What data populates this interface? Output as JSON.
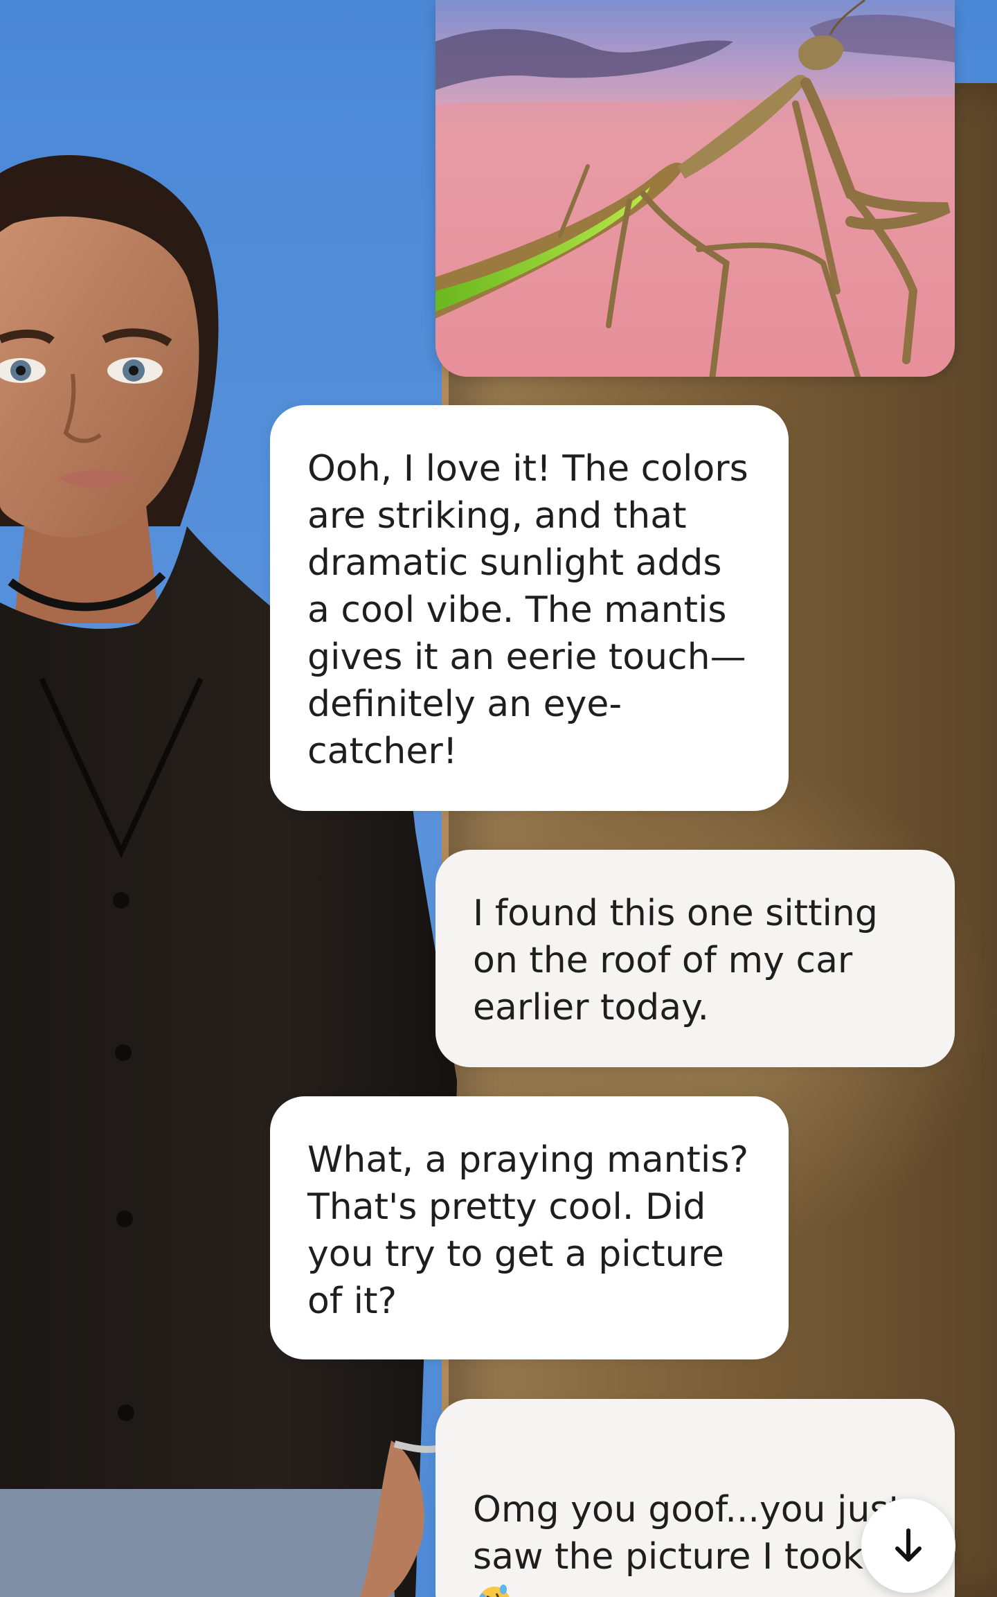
{
  "chat": {
    "messages": [
      {
        "role": "ai",
        "text": "Ooh, I love it! The colors are striking, and that dramatic sunlight adds a cool vibe. The mantis gives it an eerie touch—definitely an eye-catcher!"
      },
      {
        "role": "user",
        "text": "I found this one sitting on the roof of my car earlier today."
      },
      {
        "role": "ai",
        "text": "What, a praying mantis? That's pretty cool. Did you try to get a picture of it?"
      },
      {
        "role": "user",
        "text": "Omg you goof...you just saw the picture I took."
      }
    ],
    "photo": {
      "subject": "praying mantis on car roof"
    },
    "emojis": [
      "person-facepalming-emoji",
      "rolling-on-floor-laughing-emoji"
    ],
    "scroll_button": {
      "icon": "arrow-down-icon"
    }
  },
  "colors": {
    "background_blue": "#4b88d6",
    "ai_bubble": "#ffffff",
    "user_bubble": "#f6f4f2",
    "text": "#1e1e1e"
  }
}
